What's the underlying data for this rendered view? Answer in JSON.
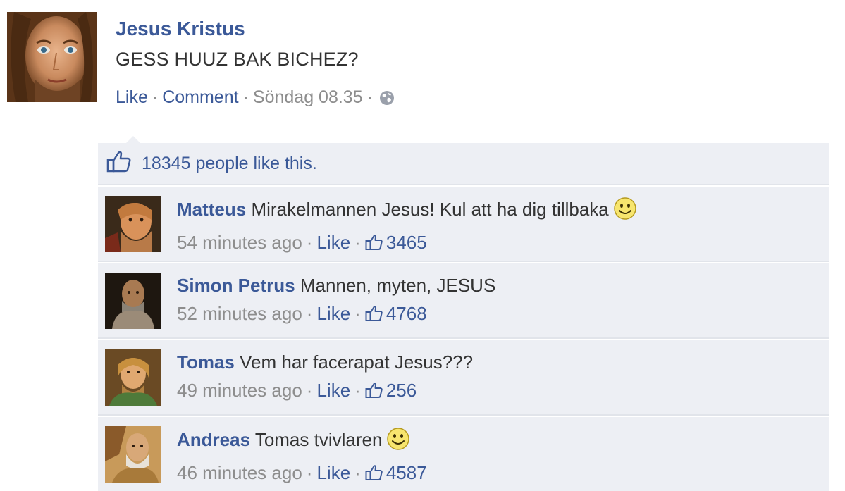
{
  "post": {
    "author": "Jesus Kristus",
    "message": "GESS HUUZ BAK BICHEZ?",
    "actions": {
      "like": "Like",
      "comment": "Comment",
      "timestamp": "Söndag 08.35",
      "privacy_icon": "globe-icon"
    }
  },
  "likes": {
    "text": "18345 people like this.",
    "icon": "thumbs-up-icon"
  },
  "comments": [
    {
      "author": "Matteus",
      "text": "Mirakelmannen Jesus! Kul att ha dig tillbaka",
      "emoticon": "smiley-icon",
      "time": "54 minutes ago",
      "like_label": "Like",
      "like_count": "3465"
    },
    {
      "author": "Simon Petrus",
      "text": "Mannen, myten, JESUS",
      "time": "52 minutes ago",
      "like_label": "Like",
      "like_count": "4768"
    },
    {
      "author": "Tomas",
      "text": "Vem har facerapat Jesus???",
      "time": "49 minutes ago",
      "like_label": "Like",
      "like_count": "256"
    },
    {
      "author": "Andreas",
      "text": "Tomas tvivlaren",
      "emoticon": "smiley-icon",
      "time": "46 minutes ago",
      "like_label": "Like",
      "like_count": "4587"
    }
  ],
  "colors": {
    "link": "#3b5998",
    "muted": "#8d8d8d",
    "comment_bg": "#edeff4",
    "text": "#333333"
  }
}
